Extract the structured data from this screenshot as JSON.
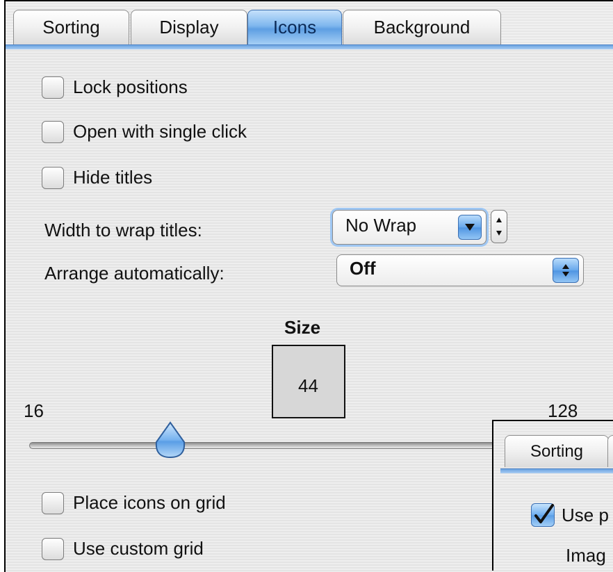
{
  "tabs": [
    {
      "label": "Sorting",
      "selected": false
    },
    {
      "label": "Display",
      "selected": false
    },
    {
      "label": "Icons",
      "selected": true
    },
    {
      "label": "Background",
      "selected": false
    }
  ],
  "options": {
    "lock_positions": {
      "label": "Lock positions",
      "checked": false
    },
    "open_single_click": {
      "label": "Open with single click",
      "checked": false
    },
    "hide_titles": {
      "label": "Hide titles",
      "checked": false
    },
    "place_on_grid": {
      "label": "Place icons on grid",
      "checked": false
    },
    "custom_grid": {
      "label": "Use custom grid",
      "checked": false
    }
  },
  "wrap": {
    "label": "Width to wrap titles:",
    "value": "No Wrap"
  },
  "arrange": {
    "label": "Arrange automatically:",
    "value": "Off"
  },
  "size": {
    "label": "Size",
    "value": "44",
    "min_label": "16",
    "max_label": "128",
    "min": 16,
    "max": 128,
    "current": 44
  },
  "overlay": {
    "tab_label": "Sorting",
    "checkbox_label": "Use p",
    "checkbox_checked": true,
    "partial_label": "Imag"
  },
  "colors": {
    "accent": "#5e9fe3",
    "tab_rule": "#6ba3e0",
    "background": "#eeeeee"
  }
}
